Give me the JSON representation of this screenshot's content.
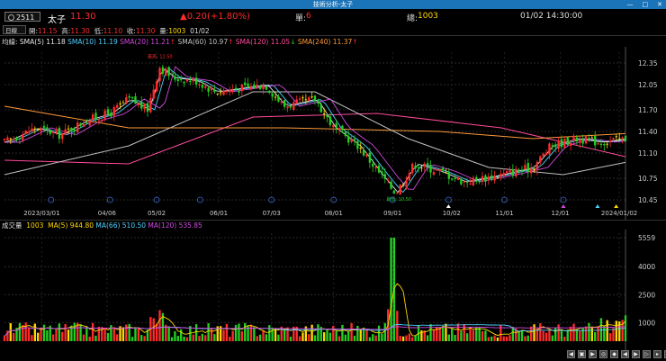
{
  "window": {
    "title": "技術分析-太子",
    "buttons": [
      "—",
      "□",
      "✕"
    ]
  },
  "header": {
    "code": "2511",
    "name": "太子",
    "price": "11.30",
    "change": "▲0.20(+1.80%)",
    "single_label": "單:",
    "single_value": "6",
    "total_label": "總:",
    "total_value": "1003",
    "datetime": "01/02 14:30:00"
  },
  "ohlc": {
    "period": "日線",
    "open_label": "開:",
    "open": "11.15",
    "high_label": "高:",
    "high": "11.30",
    "low_label": "低:",
    "low": "11.10",
    "close_label": "收:",
    "close": "11.30",
    "vol_label": "量:",
    "vol": "1003",
    "date": "01/02"
  },
  "price_panel": {
    "label": "均線",
    "indicators": [
      {
        "text": "SMA(5) 11.18",
        "color": "#e8e8e8"
      },
      {
        "text": "SMA(10) 11.19",
        "color": "#4fd0ff"
      },
      {
        "text": "SMA(20) 11.21",
        "color": "#d048e0"
      },
      {
        "text": "SMA(60) 10.97",
        "color": "#c0c0c0"
      },
      {
        "text": "SMA(120) 11.05",
        "color": "#ff4a9a"
      },
      {
        "text": "SMA(240) 11.37",
        "color": "#ff9a3a"
      }
    ],
    "arrow_down": "↓",
    "arrow_up": "↑",
    "high_marker": "最高: 12.50",
    "low_marker": "最低: 10.50"
  },
  "volume_panel": {
    "label": "成交量",
    "indicators": [
      {
        "text": "1003",
        "color": "#ffd800"
      },
      {
        "text": "MA(5) 944.80",
        "color": "#ffd800"
      },
      {
        "text": "MA(66) 510.50",
        "color": "#4fd0ff"
      },
      {
        "text": "MA(120) 535.85",
        "color": "#d048e0"
      }
    ]
  },
  "colors": {
    "up": "#ff2b2b",
    "down": "#22d022",
    "flat": "#ffd800"
  },
  "chart_data": [
    {
      "type": "candlestick",
      "title": "",
      "x_ticks": [
        "2023/03/01",
        "04/06",
        "05/02",
        "06/01",
        "07/03",
        "08/01",
        "09/01",
        "10/02",
        "11/01",
        "12/01",
        "2024/01/02"
      ],
      "y_ticks": [
        10.45,
        10.75,
        11.1,
        11.4,
        11.7,
        12.05,
        12.35
      ],
      "ylim": [
        10.4,
        12.5
      ],
      "close_path": [
        {
          "x": 0,
          "y": 11.25
        },
        {
          "x": 0.05,
          "y": 11.45
        },
        {
          "x": 0.09,
          "y": 11.35
        },
        {
          "x": 0.13,
          "y": 11.55
        },
        {
          "x": 0.17,
          "y": 11.65
        },
        {
          "x": 0.2,
          "y": 11.85
        },
        {
          "x": 0.23,
          "y": 11.7
        },
        {
          "x": 0.25,
          "y": 12.3
        },
        {
          "x": 0.27,
          "y": 12.15
        },
        {
          "x": 0.31,
          "y": 12.1
        },
        {
          "x": 0.34,
          "y": 11.95
        },
        {
          "x": 0.38,
          "y": 12.0
        },
        {
          "x": 0.42,
          "y": 12.05
        },
        {
          "x": 0.45,
          "y": 11.75
        },
        {
          "x": 0.5,
          "y": 11.85
        },
        {
          "x": 0.53,
          "y": 11.45
        },
        {
          "x": 0.57,
          "y": 11.2
        },
        {
          "x": 0.61,
          "y": 10.75
        },
        {
          "x": 0.63,
          "y": 10.55
        },
        {
          "x": 0.66,
          "y": 10.95
        },
        {
          "x": 0.7,
          "y": 10.85
        },
        {
          "x": 0.74,
          "y": 10.7
        },
        {
          "x": 0.8,
          "y": 10.8
        },
        {
          "x": 0.85,
          "y": 10.9
        },
        {
          "x": 0.88,
          "y": 11.2
        },
        {
          "x": 0.92,
          "y": 11.3
        },
        {
          "x": 0.96,
          "y": 11.25
        },
        {
          "x": 1.0,
          "y": 11.3
        }
      ],
      "ma_lines": [
        {
          "name": "SMA(120)",
          "color": "#ff4a9a",
          "points": [
            {
              "x": 0,
              "y": 11.0
            },
            {
              "x": 0.2,
              "y": 10.95
            },
            {
              "x": 0.4,
              "y": 11.6
            },
            {
              "x": 0.6,
              "y": 11.65
            },
            {
              "x": 0.8,
              "y": 11.45
            },
            {
              "x": 1.0,
              "y": 11.05
            }
          ]
        },
        {
          "name": "SMA(240)",
          "color": "#ff9a3a",
          "points": [
            {
              "x": 0,
              "y": 11.75
            },
            {
              "x": 0.2,
              "y": 11.45
            },
            {
              "x": 0.45,
              "y": 11.45
            },
            {
              "x": 0.7,
              "y": 11.4
            },
            {
              "x": 0.85,
              "y": 11.3
            },
            {
              "x": 1.0,
              "y": 11.37
            }
          ]
        },
        {
          "name": "SMA(60)",
          "color": "#c0c0c0",
          "points": [
            {
              "x": 0,
              "y": 10.8
            },
            {
              "x": 0.2,
              "y": 11.2
            },
            {
              "x": 0.4,
              "y": 11.95
            },
            {
              "x": 0.5,
              "y": 11.95
            },
            {
              "x": 0.65,
              "y": 11.3
            },
            {
              "x": 0.78,
              "y": 10.9
            },
            {
              "x": 0.9,
              "y": 10.8
            },
            {
              "x": 1.0,
              "y": 10.97
            }
          ]
        }
      ],
      "volume": {
        "yticks": [
          1000,
          2500,
          4000,
          5559
        ],
        "ylim": [
          0,
          5800
        ],
        "peak": {
          "x": 0.625,
          "value": 5559
        }
      }
    }
  ]
}
